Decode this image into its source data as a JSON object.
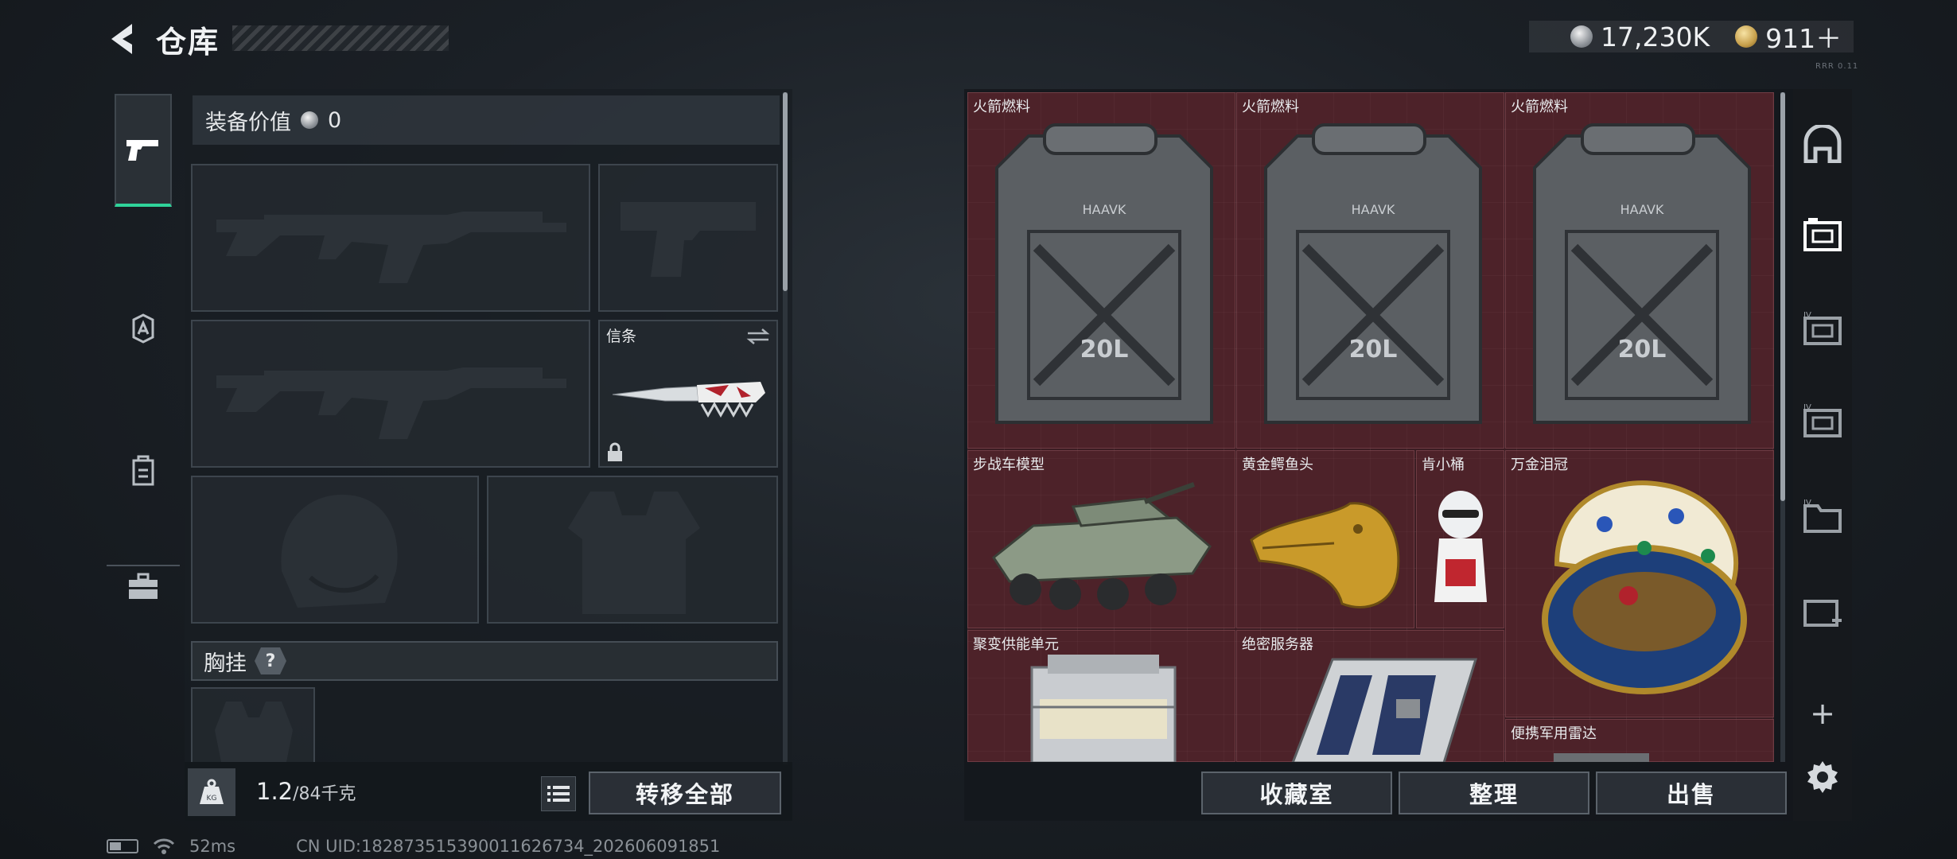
{
  "header": {
    "title": "仓库",
    "currency": [
      {
        "icon": "silver-coin-icon",
        "value": "17,230K"
      },
      {
        "icon": "gold-coin-icon",
        "value": "911＋"
      }
    ],
    "tiny_tag": "RRR 0.11"
  },
  "categories": [
    {
      "name": "weapons",
      "icon": "pistol-icon",
      "active": true
    },
    {
      "name": "armor",
      "icon": "helmet-badge-icon",
      "active": false
    },
    {
      "name": "gear",
      "icon": "backpack-icon",
      "active": false
    },
    {
      "name": "supplies",
      "icon": "toolbox-icon",
      "active": false
    }
  ],
  "equipment": {
    "value_label": "装备价值",
    "value": "0",
    "slots": {
      "primary_1": {
        "label": "",
        "icon": "assault-rifle-silhouette-icon"
      },
      "sidearm": {
        "label": "",
        "icon": "pistol-silhouette-icon"
      },
      "primary_2": {
        "label": "",
        "icon": "assault-rifle-silhouette-icon"
      },
      "melee": {
        "label": "信条",
        "icon": "knife-icon",
        "locked": true
      },
      "helmet": {
        "label": "",
        "icon": "helmet-silhouette-icon"
      },
      "armor": {
        "label": "",
        "icon": "vest-silhouette-icon"
      }
    },
    "chest_rig_label": "胸挂",
    "chest_rig_help": "?",
    "weight_current": "1.2",
    "weight_max": "/84千克",
    "transfer_all": "转移全部"
  },
  "storage": {
    "items": [
      {
        "name": "火箭燃料",
        "icon": "jerrycan-icon",
        "cap": "20L",
        "brand": "HAAVK"
      },
      {
        "name": "火箭燃料",
        "icon": "jerrycan-icon",
        "cap": "20L",
        "brand": "HAAVK"
      },
      {
        "name": "火箭燃料",
        "icon": "jerrycan-icon",
        "cap": "20L",
        "brand": "HAAVK"
      },
      {
        "name": "步战车模型",
        "icon": "ifv-model-icon"
      },
      {
        "name": "黄金鳄鱼头",
        "icon": "gold-crocodile-head-icon"
      },
      {
        "name": "肯小桶",
        "icon": "figurine-icon"
      },
      {
        "name": "万金泪冠",
        "icon": "jeweled-egg-icon"
      },
      {
        "name": "聚变供能单元",
        "icon": "fusion-cell-icon"
      },
      {
        "name": "绝密服务器",
        "icon": "server-board-icon"
      },
      {
        "name": "便携军用雷达",
        "icon": "radar-icon"
      }
    ],
    "buttons": {
      "collection": "收藏室",
      "sort": "整理",
      "sell": "出售"
    }
  },
  "rail": {
    "add": "+"
  },
  "status": {
    "ping": "52ms",
    "uid": "CN UID:182873515390011626734_202606091851"
  },
  "colors": {
    "accent_green": "#2fd39a",
    "grid_bg": "#3b1d23"
  }
}
